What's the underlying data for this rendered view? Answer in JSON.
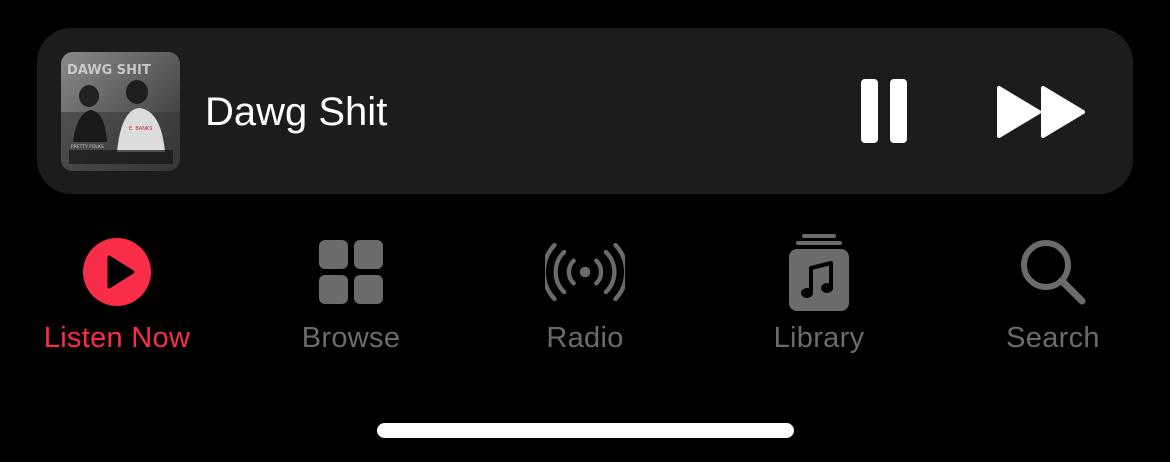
{
  "now_playing": {
    "track_title": "Dawg Shit",
    "artwork_icon": "album-artwork",
    "artwork_text": {
      "top": "DAWG SHIT",
      "right": "E. BANKS",
      "bottom": "PRETTY FOLKS"
    },
    "controls": {
      "pause_icon": "pause-icon",
      "skip_icon": "fast-forward-icon"
    }
  },
  "tabs": [
    {
      "id": "listen-now",
      "label": "Listen Now",
      "icon": "play-circle-icon",
      "active": true
    },
    {
      "id": "browse",
      "label": "Browse",
      "icon": "grid-icon",
      "active": false
    },
    {
      "id": "radio",
      "label": "Radio",
      "icon": "broadcast-icon",
      "active": false
    },
    {
      "id": "library",
      "label": "Library",
      "icon": "music-library-icon",
      "active": false
    },
    {
      "id": "search",
      "label": "Search",
      "icon": "search-icon",
      "active": false
    }
  ],
  "colors": {
    "accent": "#fa2d48",
    "inactive": "#6b6b6e",
    "player_bg": "#1c1c1e",
    "background": "#000000",
    "text": "#ffffff"
  }
}
